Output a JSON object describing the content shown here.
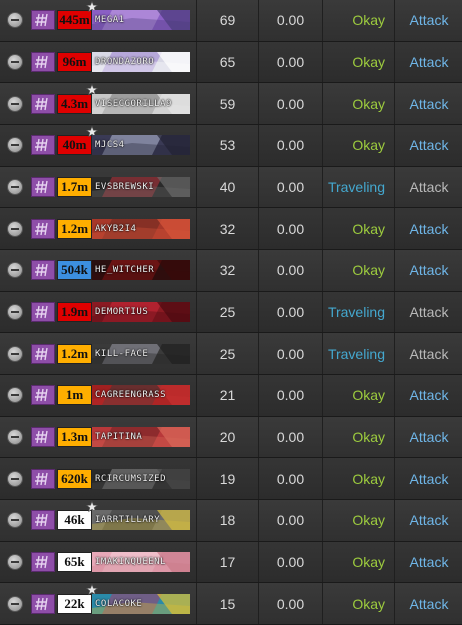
{
  "colors": {
    "okay": "#9dcc3e",
    "traveling": "#44a8cf",
    "attack_enabled": "#6fb6e8",
    "attack_disabled": "#b9b9b9",
    "faction_purple": "#8e4ea8"
  },
  "icons": {
    "remove": "remove-circle-icon",
    "faction": "faction-logo-icon",
    "star": "star-icon"
  },
  "rows": [
    {
      "bounty": "445m",
      "badge": "red",
      "star": true,
      "name": "MEGA1",
      "level": "69",
      "points": "0.00",
      "status": "Okay",
      "attack": "Attack",
      "attack_enabled": true,
      "banner": [
        "#8a5fc4",
        "#c9a6e8",
        "#4a3b7a"
      ]
    },
    {
      "bounty": "96m",
      "badge": "red",
      "star": false,
      "name": "DRONDAZORO",
      "level": "65",
      "points": "0.00",
      "status": "Okay",
      "attack": "Attack",
      "attack_enabled": true,
      "banner": [
        "#d9d9e6",
        "#9b7fd0",
        "#ffffff"
      ]
    },
    {
      "bounty": "4.3m",
      "badge": "red",
      "star": true,
      "name": "VISECGORILLA9",
      "level": "59",
      "points": "0.00",
      "status": "Okay",
      "attack": "Attack",
      "attack_enabled": true,
      "banner": [
        "#c8c8c8",
        "#7a7a7a",
        "#e6e6e6"
      ]
    },
    {
      "bounty": "40m",
      "badge": "red",
      "star": true,
      "name": "MJCS4",
      "level": "53",
      "points": "0.00",
      "status": "Okay",
      "attack": "Attack",
      "attack_enabled": true,
      "banner": [
        "#3a3a55",
        "#b8c0d8",
        "#222233"
      ]
    },
    {
      "bounty": "1.7m",
      "badge": "yellow",
      "star": false,
      "name": "EVSBREWSKI",
      "level": "40",
      "points": "0.00",
      "status": "Traveling",
      "attack": "Attack",
      "attack_enabled": false,
      "banner": [
        "#2a2a2a",
        "#b8323a",
        "#6a6a6a"
      ]
    },
    {
      "bounty": "1.2m",
      "badge": "yellow",
      "star": false,
      "name": "AKYB2I4",
      "level": "32",
      "points": "0.00",
      "status": "Okay",
      "attack": "Attack",
      "attack_enabled": true,
      "banner": [
        "#a8382a",
        "#6a2a20",
        "#d8563a"
      ]
    },
    {
      "bounty": "504k",
      "badge": "blue",
      "star": false,
      "name": "HE_WITCHER",
      "level": "32",
      "points": "0.00",
      "status": "Okay",
      "attack": "Attack",
      "attack_enabled": true,
      "banner": [
        "#2a1010",
        "#a01818",
        "#3a0a0a"
      ]
    },
    {
      "bounty": "1.9m",
      "badge": "red",
      "star": false,
      "name": "DEMORTIUS",
      "level": "25",
      "points": "0.00",
      "status": "Traveling",
      "attack": "Attack",
      "attack_enabled": false,
      "banner": [
        "#8a1a22",
        "#d02a3a",
        "#4a0a10"
      ]
    },
    {
      "bounty": "1.2m",
      "badge": "yellow",
      "star": false,
      "name": "KILL-FACE",
      "level": "25",
      "points": "0.00",
      "status": "Traveling",
      "attack": "Attack",
      "attack_enabled": false,
      "banner": [
        "#3a3a3a",
        "#9a9aa8",
        "#202020"
      ]
    },
    {
      "bounty": "1m",
      "badge": "yellow",
      "star": false,
      "name": "CAGREENGRASS",
      "level": "21",
      "points": "0.00",
      "status": "Okay",
      "attack": "Attack",
      "attack_enabled": true,
      "banner": [
        "#a02020",
        "#3a3a3a",
        "#c83030"
      ]
    },
    {
      "bounty": "1.3m",
      "badge": "yellow",
      "star": false,
      "name": "TAPITINA",
      "level": "20",
      "points": "0.00",
      "status": "Okay",
      "attack": "Attack",
      "attack_enabled": true,
      "banner": [
        "#b8383a",
        "#6a2022",
        "#d86a5a"
      ]
    },
    {
      "bounty": "620k",
      "badge": "yellow",
      "star": false,
      "name": "RCIRCUMSIZED",
      "level": "19",
      "points": "0.00",
      "status": "Okay",
      "attack": "Attack",
      "attack_enabled": true,
      "banner": [
        "#2a2a2a",
        "#8a8a8a",
        "#4a4a4a"
      ]
    },
    {
      "bounty": "46k",
      "badge": "white",
      "star": true,
      "name": "IARRTILLARY",
      "level": "18",
      "points": "0.00",
      "status": "Okay",
      "attack": "Attack",
      "attack_enabled": true,
      "banner": [
        "#6a6a6a",
        "#3a3a3a",
        "#d8c040"
      ]
    },
    {
      "bounty": "65k",
      "badge": "white",
      "star": false,
      "name": "IMAKINQUEENL",
      "level": "17",
      "points": "0.00",
      "status": "Okay",
      "attack": "Attack",
      "attack_enabled": true,
      "banner": [
        "#e8a8b8",
        "#f4d0d8",
        "#c87888"
      ]
    },
    {
      "bounty": "22k",
      "badge": "white",
      "star": true,
      "name": "COLACOKE",
      "level": "15",
      "points": "0.00",
      "status": "Okay",
      "attack": "Attack",
      "attack_enabled": true,
      "banner": [
        "#2a8aa8",
        "#a83a6a",
        "#e0c030"
      ]
    }
  ]
}
